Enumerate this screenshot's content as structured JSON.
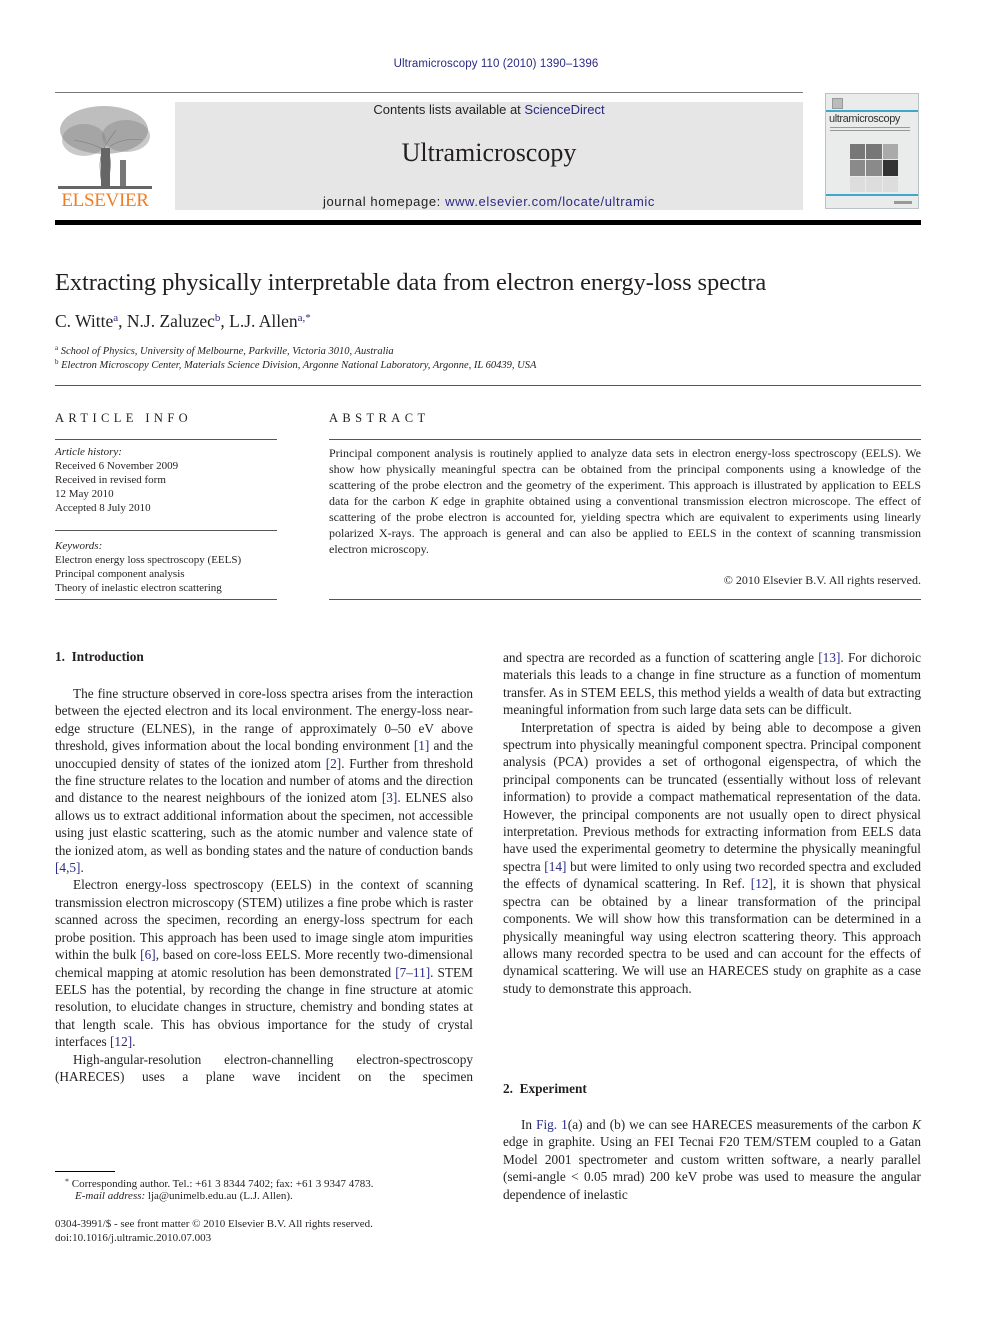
{
  "citation": "Ultramicroscopy 110 (2010) 1390–1396",
  "header": {
    "publisher_logo_text": "ELSEVIER",
    "contents_prefix": "Contents lists available at ",
    "contents_link": "ScienceDirect",
    "journal_title": "Ultramicroscopy",
    "homepage_prefix": "journal homepage: ",
    "homepage_link": "www.elsevier.com/locate/ultramic",
    "cover_title": "ultramicroscopy"
  },
  "colors": {
    "link": "#2a2a86",
    "elsevier_orange": "#f07e26",
    "header_box": "#e6e6e6",
    "cover_accent": "#3fa8c9"
  },
  "article": {
    "title": "Extracting physically interpretable data from electron energy-loss spectra",
    "authors": [
      {
        "name": "C. Witte",
        "sup": "a",
        "sep": ", "
      },
      {
        "name": "N.J. Zaluzec",
        "sup": "b",
        "sep": ", "
      },
      {
        "name": "L.J. Allen",
        "sup": "a,*",
        "sep": ""
      }
    ],
    "affiliations": [
      {
        "mark": "a",
        "text": "School of Physics, University of Melbourne, Parkville, Victoria 3010, Australia"
      },
      {
        "mark": "b",
        "text": "Electron Microscopy Center, Materials Science Division, Argonne National Laboratory, Argonne, IL 60439, USA"
      }
    ]
  },
  "article_info": {
    "heading": "ARTICLE INFO",
    "history_label": "Article history:",
    "history": [
      "Received 6 November 2009",
      "Received in revised form",
      "12 May 2010",
      "Accepted 8 July 2010"
    ],
    "keywords_label": "Keywords:",
    "keywords": [
      "Electron energy loss spectroscopy (EELS)",
      "Principal component analysis",
      "Theory of inelastic electron scattering"
    ]
  },
  "abstract": {
    "heading": "ABSTRACT",
    "text_1": "Principal component analysis is routinely applied to analyze data sets in electron energy-loss spectroscopy (EELS). We show how physically meaningful spectra can be obtained from the principal components using a knowledge of the scattering of the probe electron and the geometry of the experiment. This approach is illustrated by application to EELS data for the carbon ",
    "text_k": "K",
    "text_2": " edge in graphite obtained using a conventional transmission electron microscope. The effect of scattering of the probe electron is accounted for, yielding spectra which are equivalent to experiments using linearly polarized X-rays. The approach is general and can also be applied to EELS in the context of scanning transmission electron microscopy.",
    "copyright": "© 2010 Elsevier B.V. All rights reserved."
  },
  "body": {
    "sec1_heading": "1.  Introduction",
    "p1": [
      "The fine structure observed in core-loss spectra arises from the interaction between the ejected electron and its local environment. The energy-loss near-edge structure (ELNES), in the range of approximately 0–50 eV above threshold, gives information about the local bonding environment ",
      "[1]",
      " and the unoccupied density of states of the ionized atom ",
      "[2]",
      ". Further from threshold the fine structure relates to the location and number of atoms and the direction and distance to the nearest neighbours of the ionized atom ",
      "[3]",
      ". ELNES also allows us to extract additional information about the specimen, not accessible using just elastic scattering, such as the atomic number and valence state of the ionized atom, as well as bonding states and the nature of conduction bands ",
      "[4,5]",
      "."
    ],
    "p2": [
      "Electron energy-loss spectroscopy (EELS) in the context of scanning transmission electron microscopy (STEM) utilizes a fine probe which is raster scanned across the specimen, recording an energy-loss spectrum for each probe position. This approach has been used to image single atom impurities within the bulk ",
      "[6]",
      ", based on core-loss EELS. More recently two-dimensional chemical mapping at atomic resolution has been demonstrated ",
      "[7–11]",
      ". STEM EELS has the potential, by recording the change in fine structure at atomic resolution, to elucidate changes in structure, chemistry and bonding states at that length scale. This has obvious importance for the study of crystal interfaces ",
      "[12]",
      "."
    ],
    "p3_left": "High-angular-resolution electron-channelling electron-spectroscopy (HARECES) uses a plane wave incident on the specimen",
    "p3_right": [
      "and spectra are recorded as a function of scattering angle ",
      "[13]",
      ". For dichoroic materials this leads to a change in fine structure as a function of momentum transfer. As in STEM EELS, this method yields a wealth of data but extracting meaningful information from such large data sets can be difficult."
    ],
    "p4": [
      "Interpretation of spectra is aided by being able to decompose a given spectrum into physically meaningful component spectra. Principal component analysis (PCA) provides a set of orthogonal eigenspectra, of which the principal components can be truncated (essentially without loss of relevant information) to provide a compact mathematical representation of the data. However, the principal components are not usually open to direct physical interpretation. Previous methods for extracting information from EELS data have used the experimental geometry to determine the physically meaningful spectra ",
      "[14]",
      " but were limited to only using two recorded spectra and excluded the effects of dynamical scattering. In Ref. ",
      "[12]",
      ", it is shown that physical spectra can be obtained by a linear transformation of the principal components. We will show how this transformation can be determined in a physically meaningful way using electron scattering theory. This approach allows many recorded spectra to be used and can account for the effects of dynamical scattering. We will use an HARECES study on graphite as a case study to demonstrate this approach."
    ],
    "sec2_heading": "2.  Experiment",
    "p5": [
      "In ",
      "Fig. 1",
      "(a) and (b) we can see HARECES measurements of the carbon ",
      "K",
      " edge in graphite. Using an FEI Tecnai F20 TEM/STEM coupled to a Gatan Model 2001 spectrometer and custom written software, a nearly parallel (semi-angle  < 0.05 mrad) 200 keV probe was used to measure the angular dependence of inelastic"
    ]
  },
  "footnotes": {
    "corr_mark": "*",
    "corr_text": " Corresponding author. Tel.: +61 3 8344 7402; fax: +61 3 9347 4783.",
    "email_label": "E-mail address:",
    "email_text": " lja@unimelb.edu.au (L.J. Allen).",
    "issn": "0304-3991/$ - see front matter © 2010 Elsevier B.V. All rights reserved.",
    "doi": "doi:10.1016/j.ultramic.2010.07.003"
  }
}
